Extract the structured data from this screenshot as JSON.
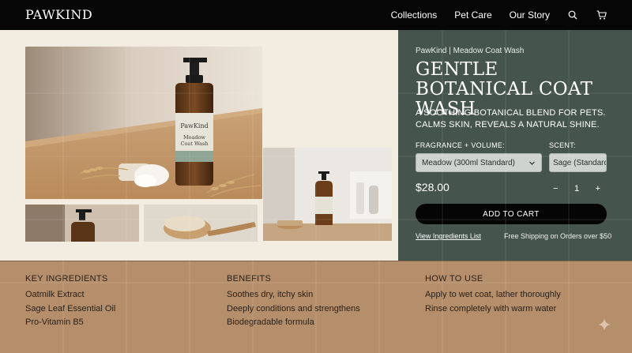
{
  "header": {
    "logo": "PAWKIND",
    "nav": [
      {
        "label": "Collections"
      },
      {
        "label": "Pet Care"
      },
      {
        "label": "Our Story"
      }
    ],
    "icons": [
      "search-icon",
      "cart-icon"
    ]
  },
  "gallery": {
    "bottle_label_brand": "PawKind",
    "bottle_label_name_1": "Meadow",
    "bottle_label_name_2": "Coat Wash"
  },
  "product": {
    "breadcrumb": "PawKind | Meadow Coat Wash",
    "title": "GENTLE BOTANICAL COAT WASH",
    "description": "A SOOTHING BOTANICAL BLEND FOR PETS. CALMS SKIN, REVEALS A NATURAL SHINE.",
    "fragrance_label": "FRAGRANCE + VOLUME:",
    "fragrance_value": "Meadow (300ml Standard)",
    "scent_label": "SCENT:",
    "scent_value": "Sage (Standard)",
    "price": "$28.00",
    "qty_minus": "−",
    "qty_value": "1",
    "qty_plus": "+",
    "cart_button": "ADD TO CART",
    "ingredients_link": "View Ingredients List",
    "shipping": "Free Shipping on Orders over $50"
  },
  "details": {
    "ingredients": {
      "title": "KEY INGREDIENTS",
      "items": [
        "Oatmilk Extract",
        "Sage Leaf Essential Oil",
        "Pro-Vitamin B5"
      ]
    },
    "benefits": {
      "title": "BENEFITS",
      "items": [
        "Soothes dry, itchy skin",
        "Deeply conditions and strengthens",
        "Biodegradable formula"
      ]
    },
    "howto": {
      "title": "HOW TO USE",
      "items": [
        "Apply to wet coat, lather thoroughly",
        "Rinse completely with warm water"
      ]
    }
  },
  "colors": {
    "header_bg": "#060606",
    "panel_green": "#46544e",
    "band_tan": "#b58f6c",
    "cream": "#f2ece1"
  }
}
